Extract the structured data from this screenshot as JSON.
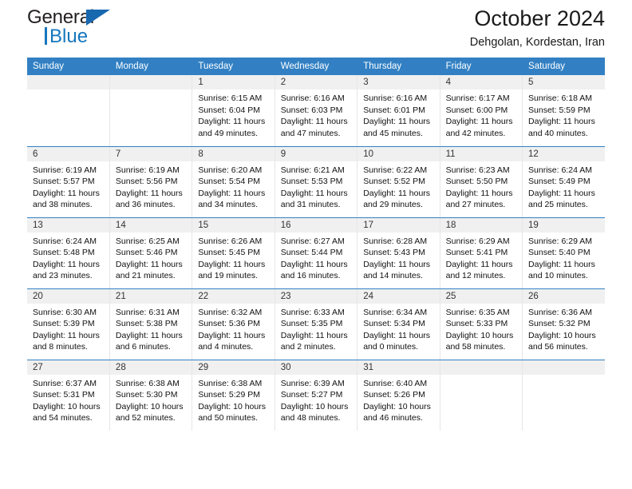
{
  "logo": {
    "word1": "General",
    "word2": "Blue",
    "triangle_color": "#1868b0",
    "blue_color": "#1576bd"
  },
  "header": {
    "title": "October 2024",
    "subtitle": "Dehgolan, Kordestan, Iran",
    "accent_color": "#3280c3"
  },
  "weekdays": [
    "Sunday",
    "Monday",
    "Tuesday",
    "Wednesday",
    "Thursday",
    "Friday",
    "Saturday"
  ],
  "weeks": [
    [
      {
        "day": "",
        "l1": "",
        "l2": "",
        "l3": "",
        "l4": ""
      },
      {
        "day": "",
        "l1": "",
        "l2": "",
        "l3": "",
        "l4": ""
      },
      {
        "day": "1",
        "l1": "Sunrise: 6:15 AM",
        "l2": "Sunset: 6:04 PM",
        "l3": "Daylight: 11 hours",
        "l4": "and 49 minutes."
      },
      {
        "day": "2",
        "l1": "Sunrise: 6:16 AM",
        "l2": "Sunset: 6:03 PM",
        "l3": "Daylight: 11 hours",
        "l4": "and 47 minutes."
      },
      {
        "day": "3",
        "l1": "Sunrise: 6:16 AM",
        "l2": "Sunset: 6:01 PM",
        "l3": "Daylight: 11 hours",
        "l4": "and 45 minutes."
      },
      {
        "day": "4",
        "l1": "Sunrise: 6:17 AM",
        "l2": "Sunset: 6:00 PM",
        "l3": "Daylight: 11 hours",
        "l4": "and 42 minutes."
      },
      {
        "day": "5",
        "l1": "Sunrise: 6:18 AM",
        "l2": "Sunset: 5:59 PM",
        "l3": "Daylight: 11 hours",
        "l4": "and 40 minutes."
      }
    ],
    [
      {
        "day": "6",
        "l1": "Sunrise: 6:19 AM",
        "l2": "Sunset: 5:57 PM",
        "l3": "Daylight: 11 hours",
        "l4": "and 38 minutes."
      },
      {
        "day": "7",
        "l1": "Sunrise: 6:19 AM",
        "l2": "Sunset: 5:56 PM",
        "l3": "Daylight: 11 hours",
        "l4": "and 36 minutes."
      },
      {
        "day": "8",
        "l1": "Sunrise: 6:20 AM",
        "l2": "Sunset: 5:54 PM",
        "l3": "Daylight: 11 hours",
        "l4": "and 34 minutes."
      },
      {
        "day": "9",
        "l1": "Sunrise: 6:21 AM",
        "l2": "Sunset: 5:53 PM",
        "l3": "Daylight: 11 hours",
        "l4": "and 31 minutes."
      },
      {
        "day": "10",
        "l1": "Sunrise: 6:22 AM",
        "l2": "Sunset: 5:52 PM",
        "l3": "Daylight: 11 hours",
        "l4": "and 29 minutes."
      },
      {
        "day": "11",
        "l1": "Sunrise: 6:23 AM",
        "l2": "Sunset: 5:50 PM",
        "l3": "Daylight: 11 hours",
        "l4": "and 27 minutes."
      },
      {
        "day": "12",
        "l1": "Sunrise: 6:24 AM",
        "l2": "Sunset: 5:49 PM",
        "l3": "Daylight: 11 hours",
        "l4": "and 25 minutes."
      }
    ],
    [
      {
        "day": "13",
        "l1": "Sunrise: 6:24 AM",
        "l2": "Sunset: 5:48 PM",
        "l3": "Daylight: 11 hours",
        "l4": "and 23 minutes."
      },
      {
        "day": "14",
        "l1": "Sunrise: 6:25 AM",
        "l2": "Sunset: 5:46 PM",
        "l3": "Daylight: 11 hours",
        "l4": "and 21 minutes."
      },
      {
        "day": "15",
        "l1": "Sunrise: 6:26 AM",
        "l2": "Sunset: 5:45 PM",
        "l3": "Daylight: 11 hours",
        "l4": "and 19 minutes."
      },
      {
        "day": "16",
        "l1": "Sunrise: 6:27 AM",
        "l2": "Sunset: 5:44 PM",
        "l3": "Daylight: 11 hours",
        "l4": "and 16 minutes."
      },
      {
        "day": "17",
        "l1": "Sunrise: 6:28 AM",
        "l2": "Sunset: 5:43 PM",
        "l3": "Daylight: 11 hours",
        "l4": "and 14 minutes."
      },
      {
        "day": "18",
        "l1": "Sunrise: 6:29 AM",
        "l2": "Sunset: 5:41 PM",
        "l3": "Daylight: 11 hours",
        "l4": "and 12 minutes."
      },
      {
        "day": "19",
        "l1": "Sunrise: 6:29 AM",
        "l2": "Sunset: 5:40 PM",
        "l3": "Daylight: 11 hours",
        "l4": "and 10 minutes."
      }
    ],
    [
      {
        "day": "20",
        "l1": "Sunrise: 6:30 AM",
        "l2": "Sunset: 5:39 PM",
        "l3": "Daylight: 11 hours",
        "l4": "and 8 minutes."
      },
      {
        "day": "21",
        "l1": "Sunrise: 6:31 AM",
        "l2": "Sunset: 5:38 PM",
        "l3": "Daylight: 11 hours",
        "l4": "and 6 minutes."
      },
      {
        "day": "22",
        "l1": "Sunrise: 6:32 AM",
        "l2": "Sunset: 5:36 PM",
        "l3": "Daylight: 11 hours",
        "l4": "and 4 minutes."
      },
      {
        "day": "23",
        "l1": "Sunrise: 6:33 AM",
        "l2": "Sunset: 5:35 PM",
        "l3": "Daylight: 11 hours",
        "l4": "and 2 minutes."
      },
      {
        "day": "24",
        "l1": "Sunrise: 6:34 AM",
        "l2": "Sunset: 5:34 PM",
        "l3": "Daylight: 11 hours",
        "l4": "and 0 minutes."
      },
      {
        "day": "25",
        "l1": "Sunrise: 6:35 AM",
        "l2": "Sunset: 5:33 PM",
        "l3": "Daylight: 10 hours",
        "l4": "and 58 minutes."
      },
      {
        "day": "26",
        "l1": "Sunrise: 6:36 AM",
        "l2": "Sunset: 5:32 PM",
        "l3": "Daylight: 10 hours",
        "l4": "and 56 minutes."
      }
    ],
    [
      {
        "day": "27",
        "l1": "Sunrise: 6:37 AM",
        "l2": "Sunset: 5:31 PM",
        "l3": "Daylight: 10 hours",
        "l4": "and 54 minutes."
      },
      {
        "day": "28",
        "l1": "Sunrise: 6:38 AM",
        "l2": "Sunset: 5:30 PM",
        "l3": "Daylight: 10 hours",
        "l4": "and 52 minutes."
      },
      {
        "day": "29",
        "l1": "Sunrise: 6:38 AM",
        "l2": "Sunset: 5:29 PM",
        "l3": "Daylight: 10 hours",
        "l4": "and 50 minutes."
      },
      {
        "day": "30",
        "l1": "Sunrise: 6:39 AM",
        "l2": "Sunset: 5:27 PM",
        "l3": "Daylight: 10 hours",
        "l4": "and 48 minutes."
      },
      {
        "day": "31",
        "l1": "Sunrise: 6:40 AM",
        "l2": "Sunset: 5:26 PM",
        "l3": "Daylight: 10 hours",
        "l4": "and 46 minutes."
      },
      {
        "day": "",
        "l1": "",
        "l2": "",
        "l3": "",
        "l4": ""
      },
      {
        "day": "",
        "l1": "",
        "l2": "",
        "l3": "",
        "l4": ""
      }
    ]
  ]
}
